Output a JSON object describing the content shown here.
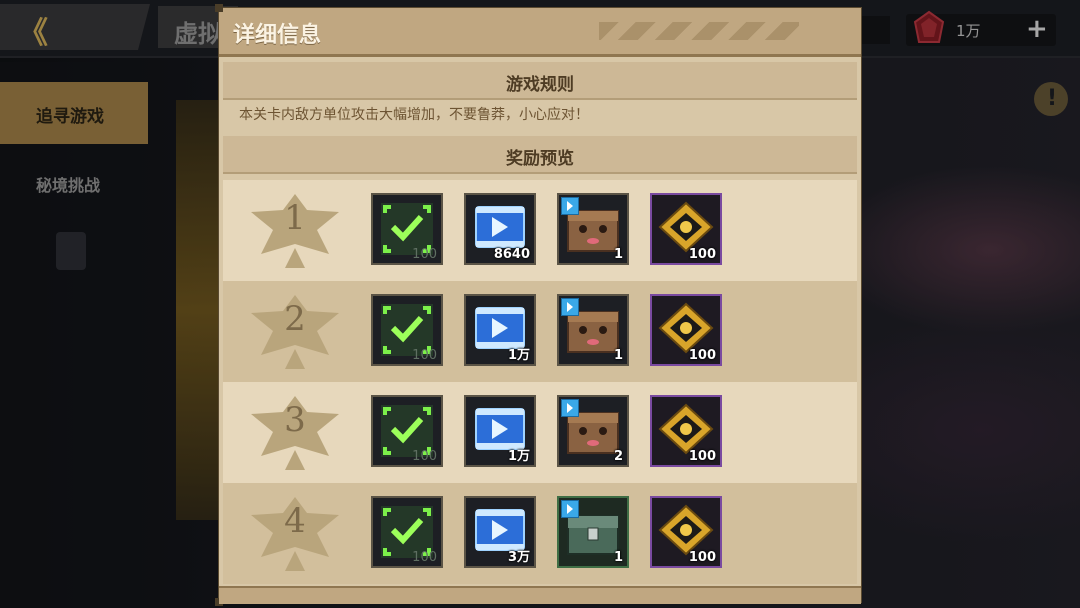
{
  "background": {
    "back_glyph": "《",
    "title_fragment": "虚拟",
    "currency_value": "1万",
    "add_glyph": "+",
    "sidebar_tabs": [
      "追寻游戏",
      "秘境挑战"
    ],
    "alert_glyph": "!"
  },
  "dialog": {
    "title": "详细信息",
    "rules_heading": "游戏规则",
    "rules_text": "本关卡内敌方单位攻击大幅增加，不要鲁莽，小心应对！",
    "rewards_heading": "奖励预览",
    "rows": [
      {
        "rank": "1",
        "items": [
          {
            "icon": "check-chip-icon",
            "qty": "100"
          },
          {
            "icon": "blue-film-icon",
            "qty": "8640"
          },
          {
            "icon": "brown-box-icon",
            "qty": "1"
          },
          {
            "icon": "gold-emblem-icon",
            "qty": "100"
          }
        ]
      },
      {
        "rank": "2",
        "items": [
          {
            "icon": "check-chip-icon",
            "qty": "100"
          },
          {
            "icon": "blue-film-icon",
            "qty": "1万"
          },
          {
            "icon": "brown-box-icon",
            "qty": "1"
          },
          {
            "icon": "gold-emblem-icon",
            "qty": "100"
          }
        ]
      },
      {
        "rank": "3",
        "items": [
          {
            "icon": "check-chip-icon",
            "qty": "100"
          },
          {
            "icon": "blue-film-icon",
            "qty": "1万"
          },
          {
            "icon": "brown-box-icon",
            "qty": "2"
          },
          {
            "icon": "gold-emblem-icon",
            "qty": "100"
          }
        ]
      },
      {
        "rank": "4",
        "items": [
          {
            "icon": "check-chip-icon",
            "qty": "100"
          },
          {
            "icon": "blue-film-icon",
            "qty": "3万"
          },
          {
            "icon": "green-chest-icon",
            "qty": "1"
          },
          {
            "icon": "gold-emblem-icon",
            "qty": "100"
          }
        ]
      }
    ]
  },
  "colors": {
    "dialog_bg": "#d8c7a7",
    "header_bg": "#c0a781",
    "accent_gold": "#d8b45a",
    "rare_purple": "#7a4aa0",
    "uncommon_green": "#3f6e45"
  }
}
